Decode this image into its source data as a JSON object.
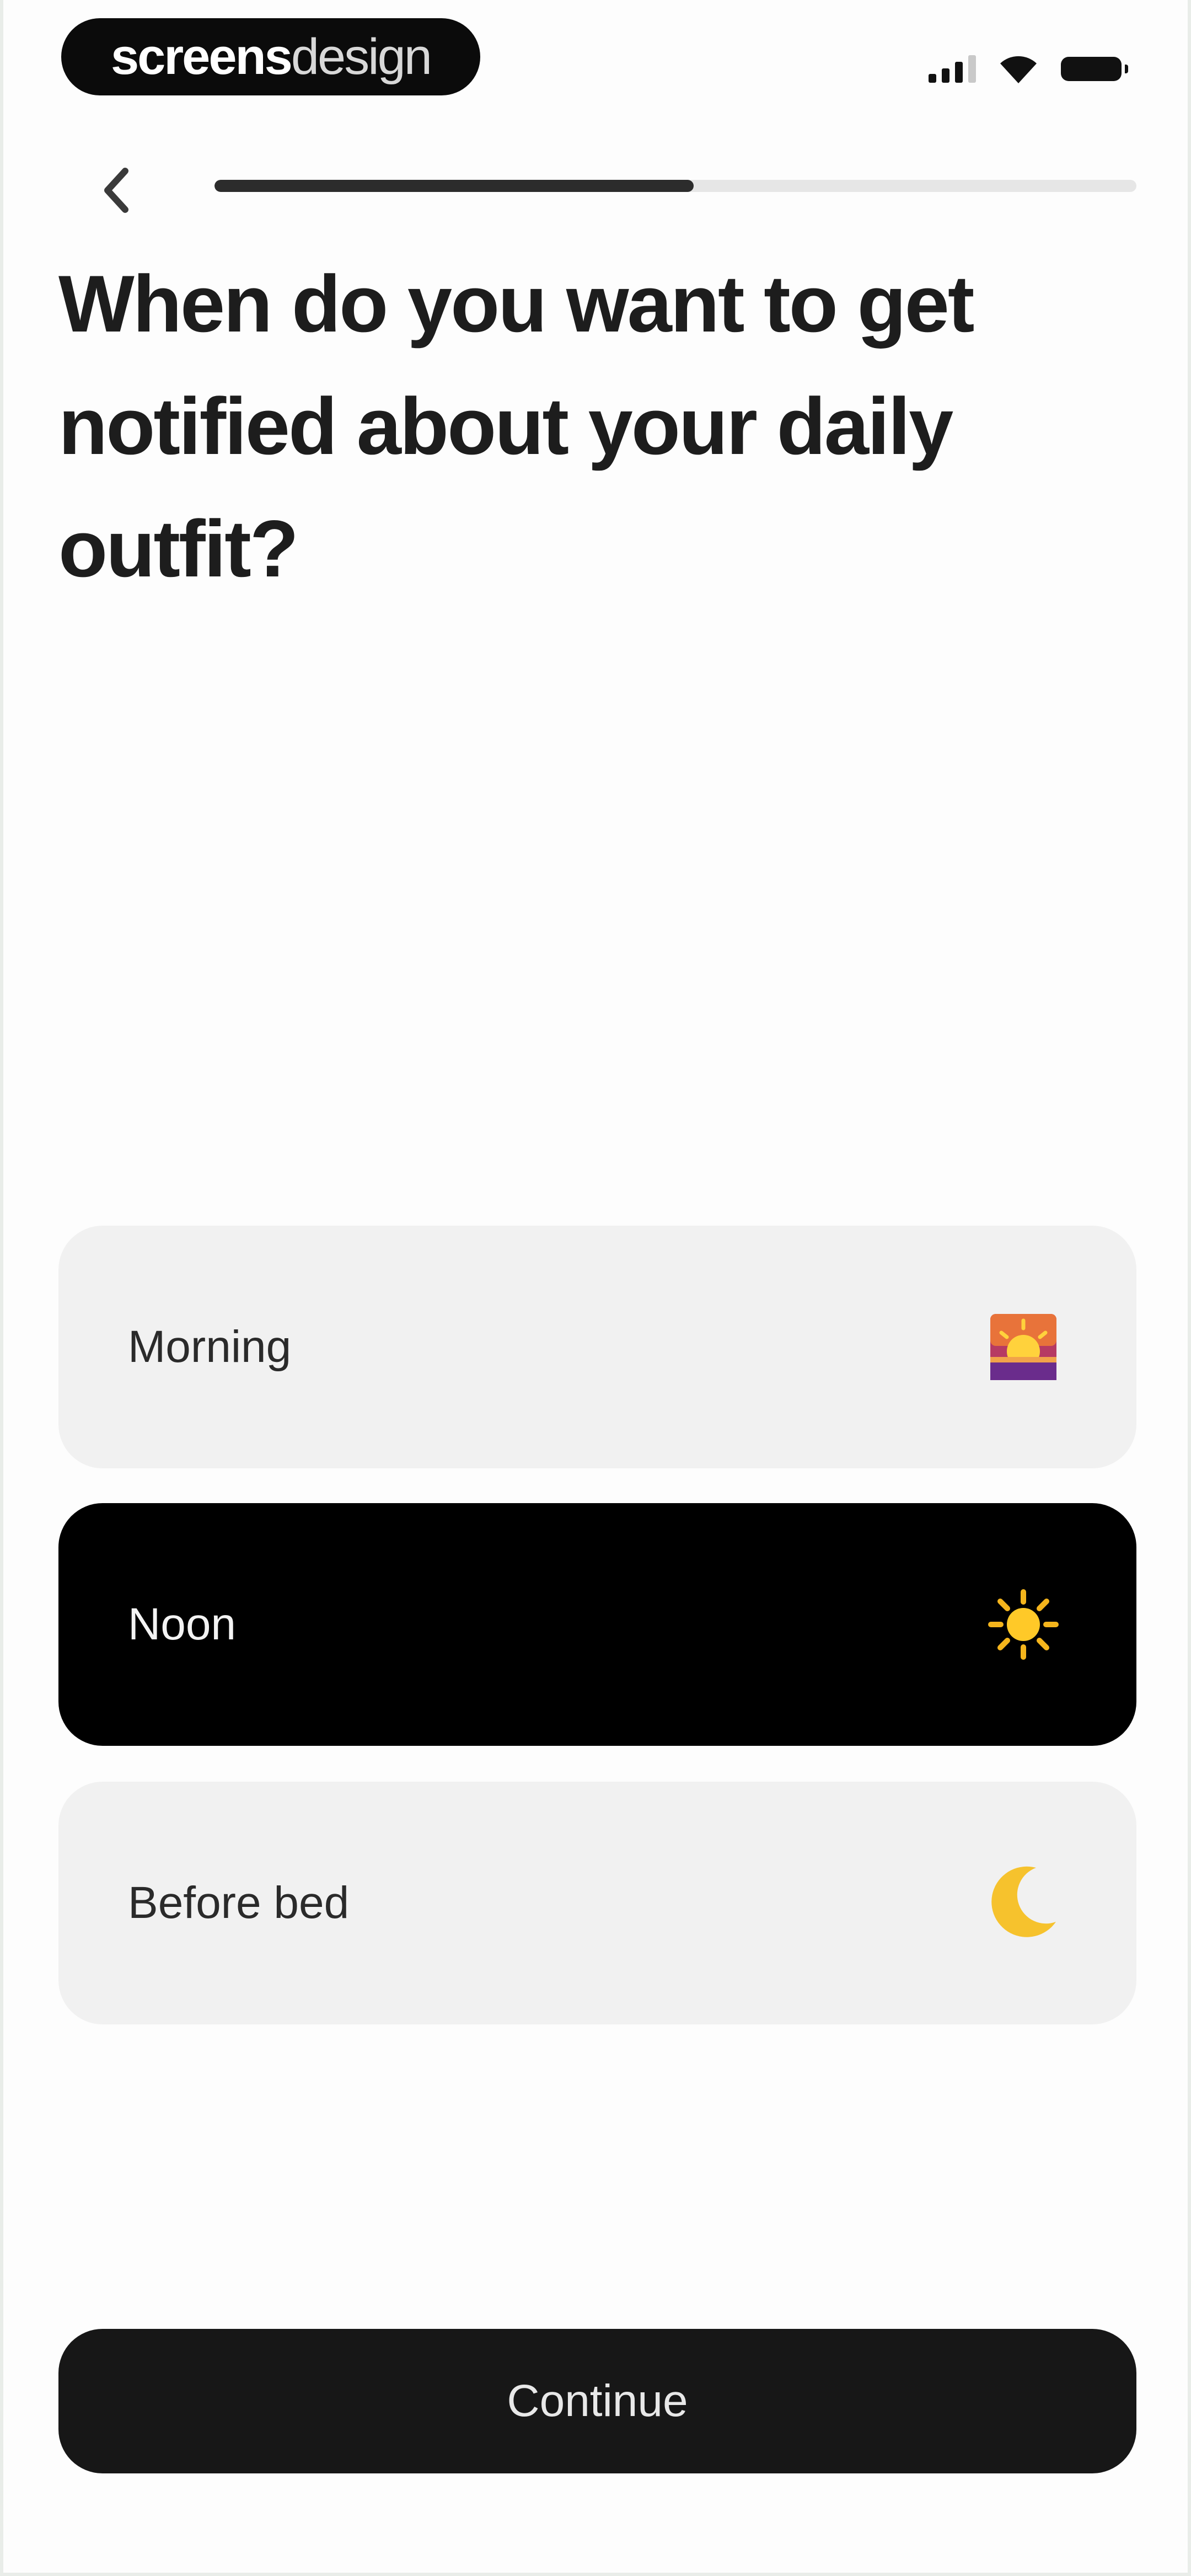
{
  "status_bar": {
    "brand_bold": "screens",
    "brand_light": "design",
    "icons": [
      "signal-icon",
      "wifi-icon",
      "battery-icon"
    ]
  },
  "nav": {
    "back_icon": "chevron-left-icon",
    "progress": 0.52
  },
  "question": "When do you want to get notified about your daily outfit?",
  "options": [
    {
      "label": "Morning",
      "icon": "sunrise-icon",
      "selected": false
    },
    {
      "label": "Noon",
      "icon": "sun-icon",
      "selected": true
    },
    {
      "label": "Before bed",
      "icon": "crescent-moon-icon",
      "selected": false
    }
  ],
  "continue_label": "Continue",
  "colors": {
    "selected_background": "#000000",
    "option_background": "#f1f1f1",
    "button_background": "#171717",
    "progress_fill": "#2c2c2c"
  }
}
